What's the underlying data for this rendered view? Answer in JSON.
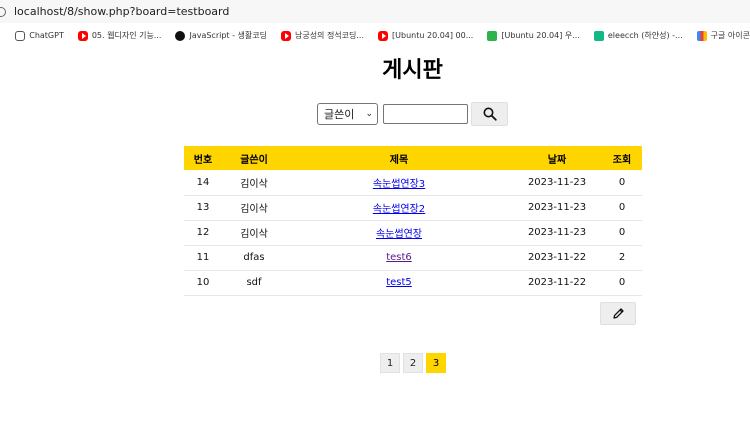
{
  "browser": {
    "url": "localhost/8/show.php?board=testboard",
    "bookmarks": [
      {
        "label": "ChatGPT",
        "icon": "chatgpt-icon"
      },
      {
        "label": "05. 웹디자인 기능...",
        "icon": "youtube-icon"
      },
      {
        "label": "JavaScript - 생활코딩",
        "icon": "javascript-icon"
      },
      {
        "label": "남궁성의 정석코딩...",
        "icon": "youtube-icon"
      },
      {
        "label": "[Ubuntu 20.04] 00...",
        "icon": "youtube-icon"
      },
      {
        "label": "[Ubuntu 20.04] 우...",
        "icon": "green-leaf-icon"
      },
      {
        "label": "eleecch (하얀성) -...",
        "icon": "velog-icon"
      },
      {
        "label": "구글 아이콘",
        "icon": "google-icon"
      }
    ]
  },
  "page": {
    "title": "게시판"
  },
  "search": {
    "select_value": "글쓴이",
    "input_value": "",
    "button_icon": "search-icon"
  },
  "table": {
    "headers": [
      "번호",
      "글쓴이",
      "제목",
      "날짜",
      "조회"
    ],
    "rows": [
      {
        "no": "14",
        "writer": "김이삭",
        "title": "속눈썹연장3",
        "date": "2023-11-23",
        "views": "0",
        "visited": false
      },
      {
        "no": "13",
        "writer": "김이삭",
        "title": "속눈썹연장2",
        "date": "2023-11-23",
        "views": "0",
        "visited": false
      },
      {
        "no": "12",
        "writer": "김이삭",
        "title": "속눈썹연장",
        "date": "2023-11-23",
        "views": "0",
        "visited": false
      },
      {
        "no": "11",
        "writer": "dfas",
        "title": "test6",
        "date": "2023-11-22",
        "views": "2",
        "visited": true
      },
      {
        "no": "10",
        "writer": "sdf",
        "title": "test5",
        "date": "2023-11-22",
        "views": "0",
        "visited": false
      }
    ]
  },
  "write_button": {
    "icon": "pencil-icon"
  },
  "pagination": {
    "pages": [
      "1",
      "2",
      "3"
    ],
    "current": "3"
  },
  "colors": {
    "accent": "#ffd500",
    "button_bg": "#eeeeee",
    "link": "#0000ee",
    "visited_link": "#551a8b"
  }
}
